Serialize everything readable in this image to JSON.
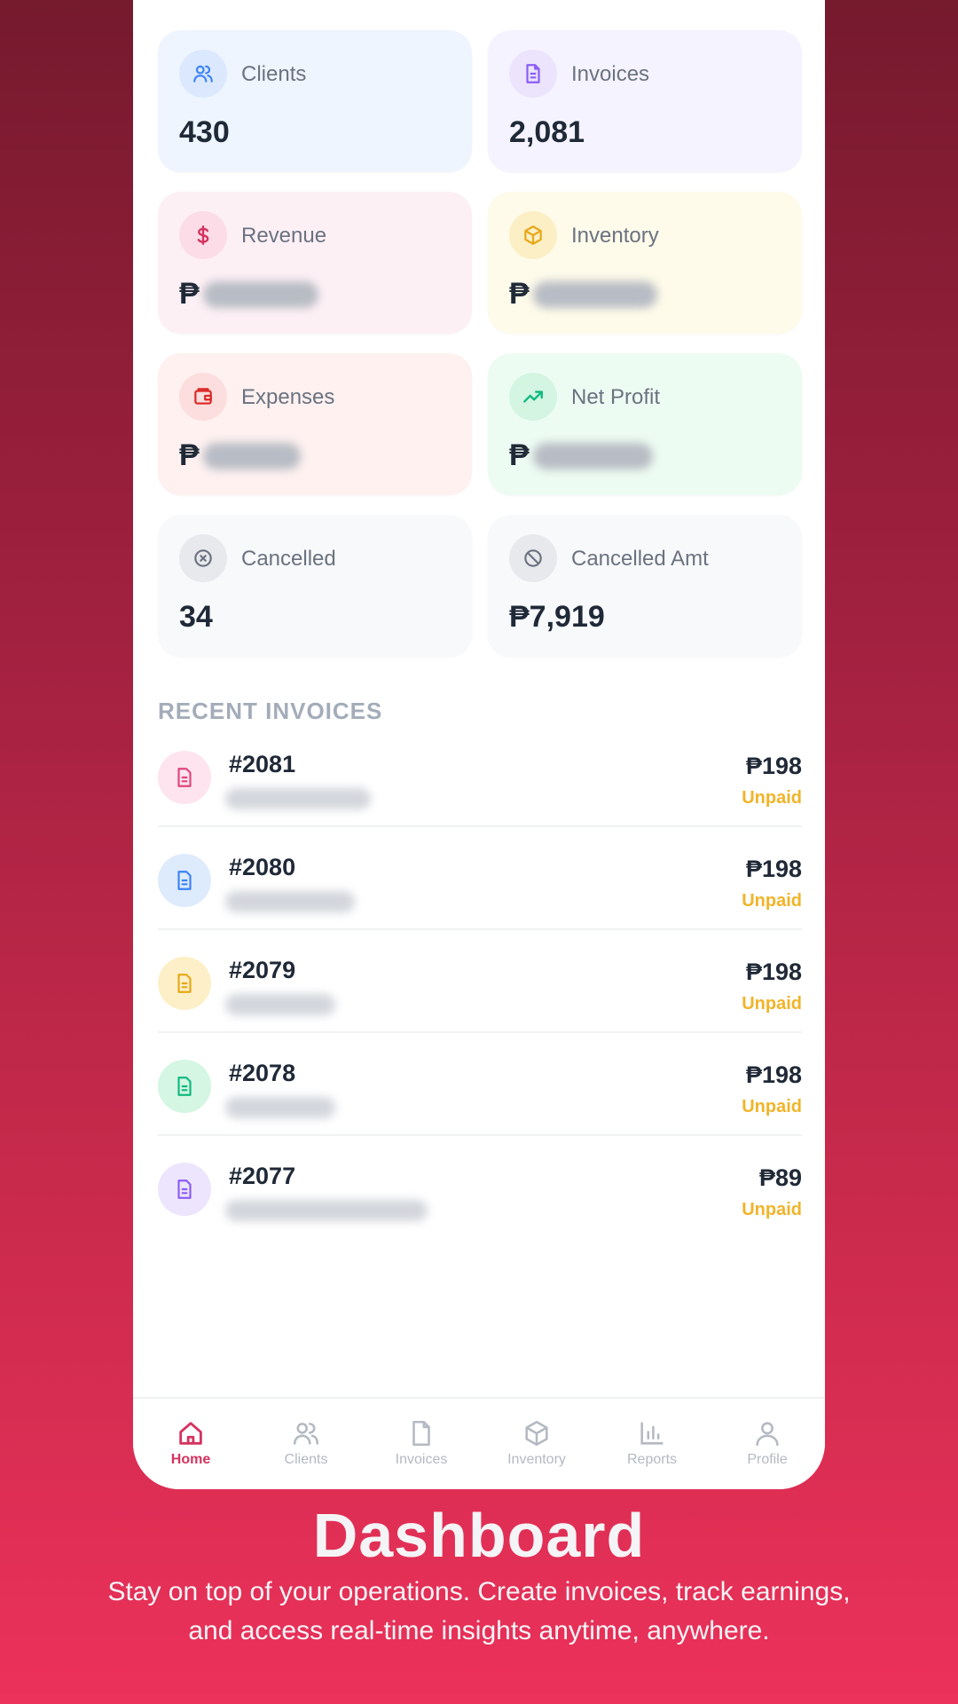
{
  "stats": [
    {
      "label": "Clients",
      "value": "430",
      "icon": "users-icon",
      "theme": "blue",
      "masked": false
    },
    {
      "label": "Invoices",
      "value": "2,081",
      "icon": "document-icon",
      "theme": "purple",
      "masked": false
    },
    {
      "label": "Revenue",
      "value": "₱",
      "icon": "dollar-icon",
      "theme": "pink",
      "masked": true
    },
    {
      "label": "Inventory",
      "value": "₱",
      "icon": "box-icon",
      "theme": "yellow",
      "masked": true
    },
    {
      "label": "Expenses",
      "value": "₱",
      "icon": "wallet-icon",
      "theme": "red",
      "masked": true
    },
    {
      "label": "Net Profit",
      "value": "₱",
      "icon": "trending-up-icon",
      "theme": "green",
      "masked": true
    },
    {
      "label": "Cancelled",
      "value": "34",
      "icon": "x-circle-icon",
      "theme": "gray",
      "masked": false
    },
    {
      "label": "Cancelled Amt",
      "value": "₱7,919",
      "icon": "ban-icon",
      "theme": "gray",
      "masked": false
    }
  ],
  "recent": {
    "title": "RECENT INVOICES",
    "items": [
      {
        "number": "#2081",
        "amount": "₱198",
        "status": "Unpaid",
        "color": "#e0457b"
      },
      {
        "number": "#2080",
        "amount": "₱198",
        "status": "Unpaid",
        "color": "#3b82f6"
      },
      {
        "number": "#2079",
        "amount": "₱198",
        "status": "Unpaid",
        "color": "#e6a817"
      },
      {
        "number": "#2078",
        "amount": "₱198",
        "status": "Unpaid",
        "color": "#10b981"
      },
      {
        "number": "#2077",
        "amount": "₱89",
        "status": "Unpaid",
        "color": "#8b5cf6"
      }
    ]
  },
  "nav": [
    {
      "label": "Home",
      "icon": "home-icon",
      "active": true
    },
    {
      "label": "Clients",
      "icon": "users-icon",
      "active": false
    },
    {
      "label": "Invoices",
      "icon": "document-icon",
      "active": false
    },
    {
      "label": "Inventory",
      "icon": "box-icon",
      "active": false
    },
    {
      "label": "Reports",
      "icon": "bar-chart-icon",
      "active": false
    },
    {
      "label": "Profile",
      "icon": "user-icon",
      "active": false
    }
  ],
  "promo": {
    "headline": "Dashboard",
    "subline": "Stay on top of your operations. Create invoices, track earnings, and access real-time insights anytime, anywhere."
  },
  "colors": {
    "accent": "#d4335f",
    "unpaid": "#f0b429",
    "background_top": "#761a2e",
    "background_bottom": "#ec315a"
  }
}
